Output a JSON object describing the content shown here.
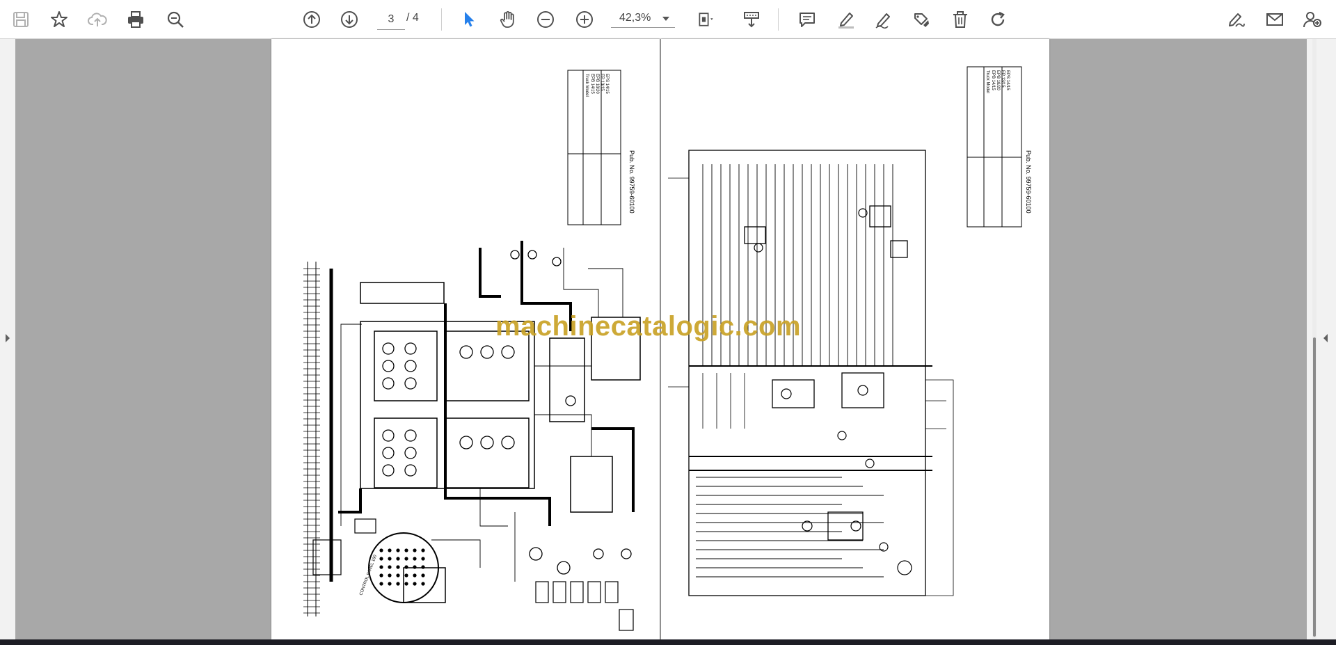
{
  "toolbar": {
    "buttons_left": [
      {
        "name": "save-icon"
      },
      {
        "name": "bookmark-star-icon"
      },
      {
        "name": "cloud-upload-icon"
      },
      {
        "name": "print-icon"
      },
      {
        "name": "zoom-out-magnifier-icon"
      }
    ],
    "navigation": {
      "prev_page_icon": "arrow-up-circle-icon",
      "next_page_icon": "arrow-down-circle-icon",
      "current_page": "3",
      "total_pages": "/ 4"
    },
    "tools": [
      {
        "name": "select-cursor-icon"
      },
      {
        "name": "hand-pan-icon"
      },
      {
        "name": "zoom-minus-icon"
      },
      {
        "name": "zoom-plus-icon"
      }
    ],
    "zoom_level": "42,3%",
    "view_tools": [
      {
        "name": "page-fit-icon"
      },
      {
        "name": "scroll-mode-icon"
      }
    ],
    "annotation_tools": [
      {
        "name": "comment-icon"
      },
      {
        "name": "highlight-pen-icon"
      },
      {
        "name": "draw-pen-icon"
      },
      {
        "name": "stamp-icon"
      },
      {
        "name": "trash-icon"
      },
      {
        "name": "redo-icon"
      }
    ],
    "right_tools": [
      {
        "name": "sign-icon"
      },
      {
        "name": "email-icon"
      },
      {
        "name": "add-user-icon"
      }
    ]
  },
  "colors": {
    "accent": "#2680eb",
    "icon": "#505050",
    "viewer_bg": "#a8a8a8",
    "watermark": "#c9a227"
  },
  "document": {
    "watermark": "machinecatalogic.com",
    "left_page": {
      "pub_no": "Pub. No. 99759-60100",
      "table_header": "Truck Model",
      "table_rows": [
        "EPB 14/15",
        "EPB 18/20",
        "EP 13/15",
        "EPS 14/15"
      ],
      "label_vertical": "CONTROL PANEL 160"
    },
    "right_page": {
      "pub_no": "Pub. No. 99759-60100",
      "table_header": "Truck Model",
      "table_rows": [
        "EPB 14/15",
        "EPB 18/20",
        "EP 13/15",
        "EPS 14/15"
      ]
    }
  }
}
